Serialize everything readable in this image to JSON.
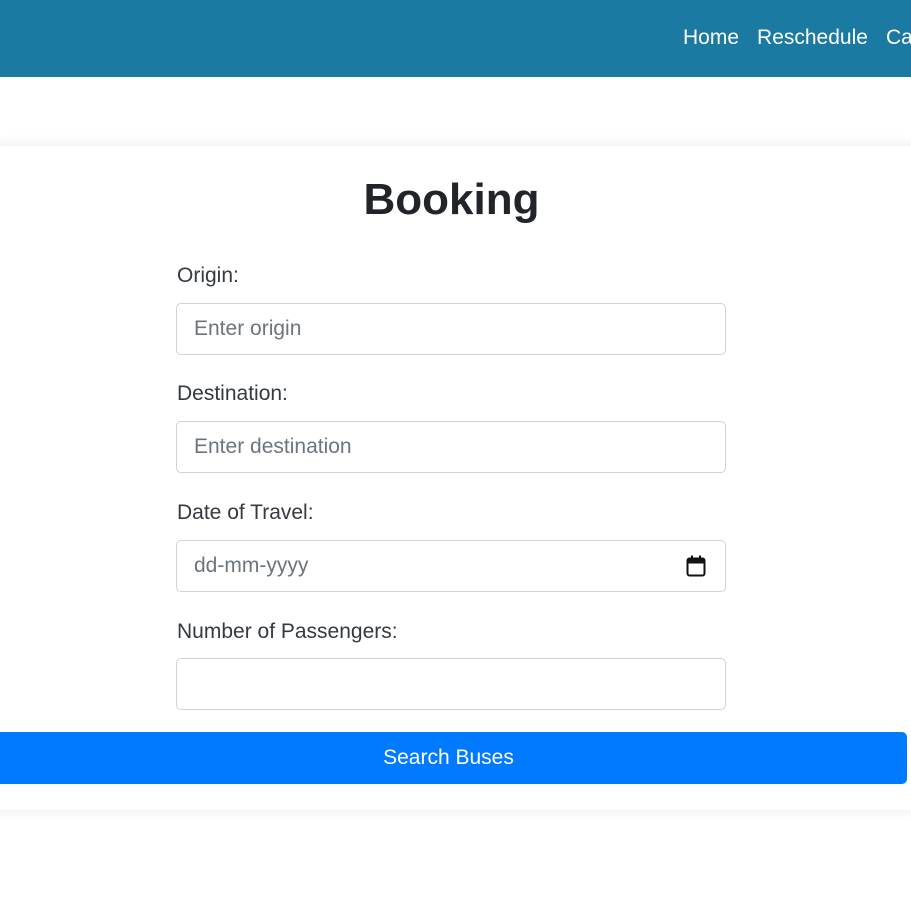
{
  "nav": {
    "links": [
      {
        "label": "Home"
      },
      {
        "label": "Reschedule"
      },
      {
        "label": "Cancel"
      }
    ]
  },
  "form": {
    "title": "Booking",
    "origin": {
      "label": "Origin:",
      "placeholder": "Enter origin",
      "value": ""
    },
    "destination": {
      "label": "Destination:",
      "placeholder": "Enter destination",
      "value": ""
    },
    "date": {
      "label": "Date of Travel:",
      "placeholder": "dd-mm-yyyy",
      "value": ""
    },
    "passengers": {
      "label": "Number of Passengers:",
      "value": ""
    },
    "submit_label": "Search Buses"
  },
  "colors": {
    "navbar": "#1a7aa1",
    "primary_button": "#007bff",
    "input_border": "#ced4da",
    "placeholder": "#6c757d"
  },
  "icons": {
    "date_picker": "calendar-icon"
  }
}
